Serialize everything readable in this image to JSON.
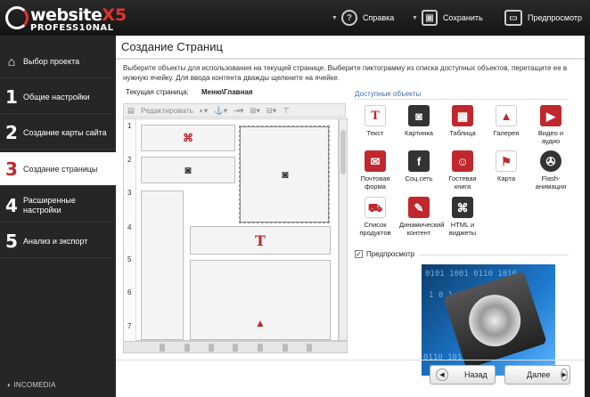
{
  "app": {
    "logo_word": "website",
    "logo_x5": "X5",
    "logo_edition": "PROFESS10NAL",
    "brand_footer": "INCOMEDIA"
  },
  "toolbar": {
    "help_label": "Справка",
    "save_label": "Сохранить",
    "preview_label": "Предпросмотр"
  },
  "sidebar": {
    "items": [
      {
        "num": "",
        "label": "Выбор проекта"
      },
      {
        "num": "1",
        "label": "Общие настройки"
      },
      {
        "num": "2",
        "label": "Создание карты сайта"
      },
      {
        "num": "3",
        "label": "Создание страницы"
      },
      {
        "num": "4",
        "label": "Расширенные настройки"
      },
      {
        "num": "5",
        "label": "Анализ и экспорт"
      }
    ]
  },
  "main": {
    "title": "Создание Страниц",
    "description": "Выберите объекты для использования на текущей странице. Выберите пиктограмму из списка доступных объектов, перетащите ее в нужную ячейку. Для ввода контента дважды щелкните на ячейке.",
    "current_page_label": "Текущая страница:",
    "current_page_value": "Меню\\Главная",
    "edit_button": "Редактировать",
    "row_numbers": [
      "1",
      "2",
      "3",
      "4",
      "5",
      "6",
      "7"
    ],
    "available_title": "Доступные объекты",
    "objects": [
      {
        "label": "Текст",
        "icon": "text-icon"
      },
      {
        "label": "Картинка",
        "icon": "camera-icon"
      },
      {
        "label": "Таблица",
        "icon": "table-icon"
      },
      {
        "label": "Галерея",
        "icon": "gallery-icon"
      },
      {
        "label": "Видео и аудио",
        "icon": "video-icon"
      },
      {
        "label": "Почтовая форма",
        "icon": "mail-icon"
      },
      {
        "label": "Соц.сеть",
        "icon": "social-icon"
      },
      {
        "label": "Гостевая книга",
        "icon": "guestbook-icon"
      },
      {
        "label": "Карта",
        "icon": "map-icon"
      },
      {
        "label": "Flash-анимация",
        "icon": "flash-icon"
      },
      {
        "label": "Список продуктов",
        "icon": "cart-icon"
      },
      {
        "label": "Динамический контент",
        "icon": "dynamic-icon"
      },
      {
        "label": "HTML и виджеты",
        "icon": "html-icon"
      }
    ],
    "preview_checkbox_label": "Предпросмотр",
    "preview_checked": true,
    "back_button": "Назад",
    "next_button": "Далее"
  },
  "colors": {
    "accent": "#c0282d",
    "link": "#3b6ea8",
    "sidebar": "#262626"
  }
}
